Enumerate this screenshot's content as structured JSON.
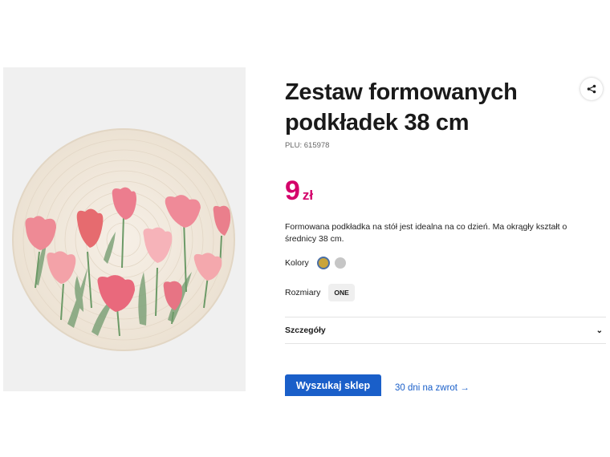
{
  "product": {
    "title_line1": "Zestaw formowanych",
    "title_line2": "podkładek 38 cm",
    "plu": "PLU: 615978",
    "price_amount": "9",
    "price_currency": "zł",
    "description": "Formowana podkładka na stół jest idealna na co dzień. Ma okrągły kształt o średnicy 38 cm.",
    "colors_label": "Kolory",
    "colors": [
      "#c9a43a",
      "#c6c6c6"
    ],
    "selected_color_index": 0,
    "sizes_label": "Rozmiary",
    "sizes": [
      "ONE"
    ],
    "details_label": "Szczegóły"
  },
  "actions": {
    "find_store_button": "Wyszukaj sklep",
    "return_link": "30 dni na zwrot"
  },
  "icons": {
    "share": "share-icon",
    "chevron": "chevron-down-icon",
    "arrow": "arrow-right-icon"
  },
  "theme": {
    "price_color": "#d4006a",
    "accent": "#1a5fc9"
  }
}
